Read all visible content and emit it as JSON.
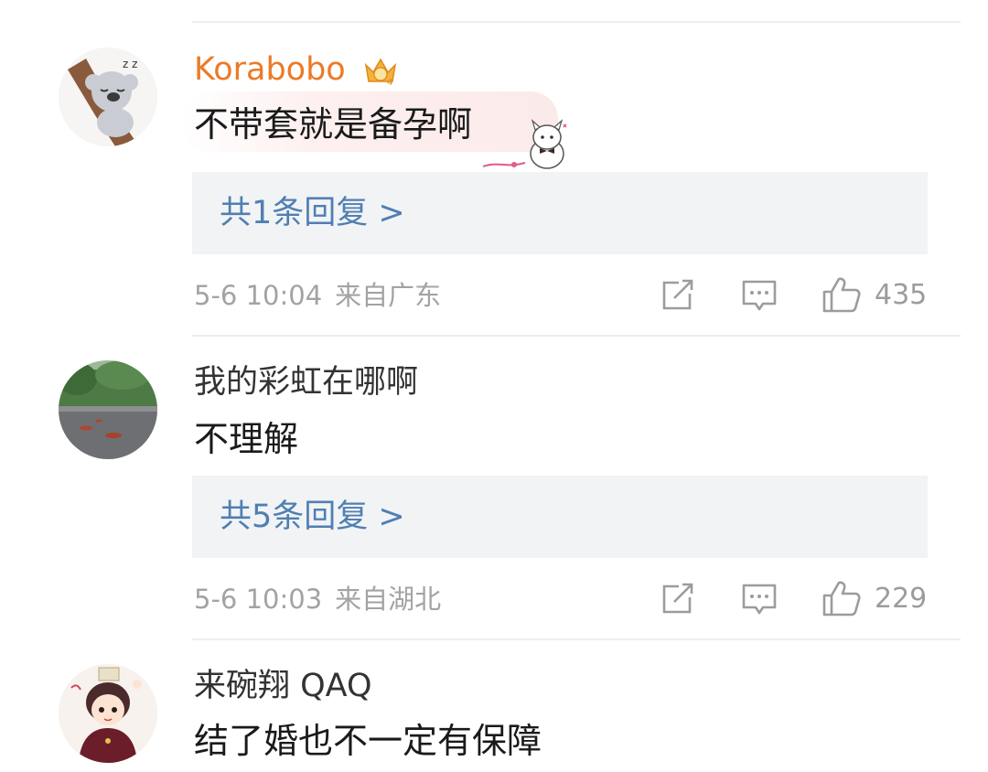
{
  "comments": [
    {
      "username": "Korabobo",
      "is_vip": true,
      "vip_badge_icon": "crown-badge-icon",
      "text": "不带套就是备孕啊",
      "has_sticker_bubble": true,
      "reply_label": "共1条回复 >",
      "date": "5-6 10:04",
      "location": "来自广东",
      "likes": "435"
    },
    {
      "username": "我的彩虹在哪啊",
      "is_vip": false,
      "text": "不理解",
      "reply_label": "共5条回复 >",
      "date": "5-6 10:03",
      "location": "来自湖北",
      "likes": "229"
    },
    {
      "username": "来碗翔 QAQ",
      "is_vip": false,
      "text": "结了婚也不一定有保障"
    }
  ],
  "colors": {
    "vip_name": "#ec7a26",
    "reply_link": "#4f7fb2",
    "reply_box_bg": "#f2f3f5",
    "meta_text": "#a3a3a3",
    "icon": "#9c9c9c"
  },
  "icons": {
    "share": "share-icon",
    "comment": "comment-icon",
    "like": "thumbs-up-icon"
  }
}
